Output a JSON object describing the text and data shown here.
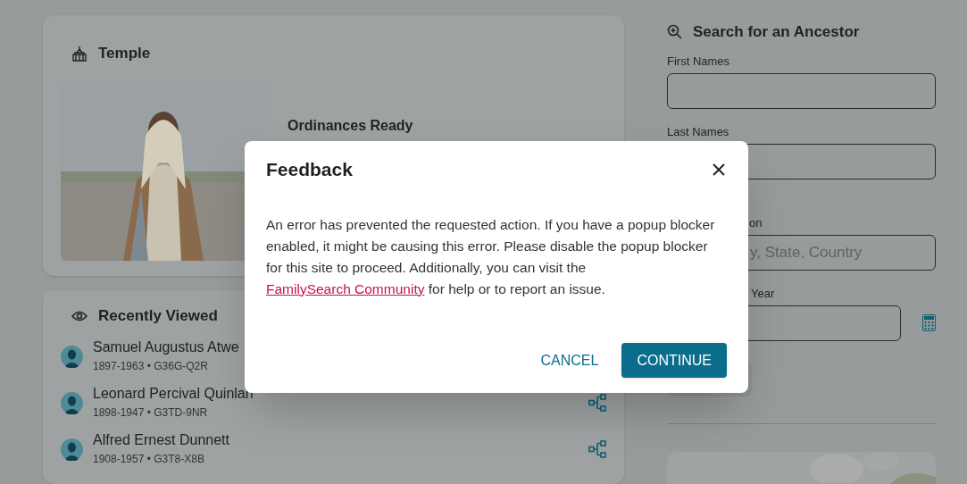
{
  "temple": {
    "title": "Temple",
    "heading": "Ordinances Ready"
  },
  "recently_viewed": {
    "title": "Recently Viewed",
    "people": [
      {
        "name": "Samuel Augustus Atwe",
        "details": "1897-1963 • G36G-Q2R"
      },
      {
        "name": "Leonard Percival Quinlan",
        "details": "1898-1947 • G3TD-9NR",
        "tree_link": true
      },
      {
        "name": "Alfred Ernest Dunnett",
        "details": "1908-1957 • G3T8-X8B",
        "tree_link": true
      }
    ]
  },
  "search": {
    "title": "Search for an Ancestor",
    "fields": [
      {
        "label": "First Names"
      },
      {
        "label": "Last Names"
      },
      {
        "label": "on",
        "placeholder": "y, State, Country",
        "kind": "place"
      },
      {
        "label": "Year",
        "kind": "year"
      }
    ]
  },
  "dialog": {
    "title": "Feedback",
    "message": "An error has prevented the requested action. If you have a popup blocker enabled, it might be causing this error. Please disable the popup blocker for this site to proceed. Additionally, you can visit the",
    "link": "FamilySearch Community",
    "message_end": "for help or to report an issue.",
    "buttons": [
      {
        "label": "CANCEL",
        "kind": "text"
      },
      {
        "label": "CONTINUE",
        "kind": "primary"
      }
    ]
  }
}
